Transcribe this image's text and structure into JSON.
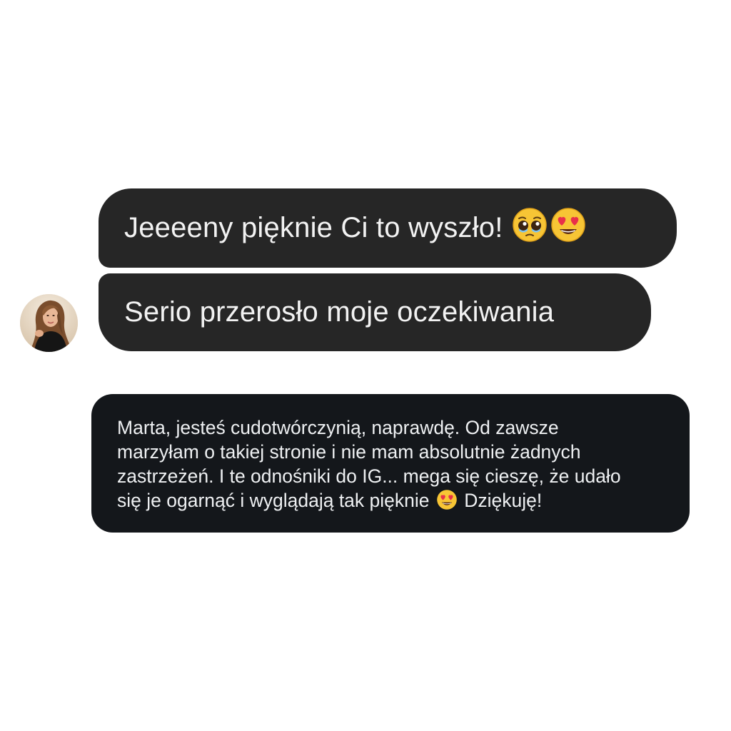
{
  "conversation": {
    "messages": [
      {
        "text": "Jeeeeny pięknie Ci to wyszło!",
        "emojis": [
          "pleading-face-icon",
          "heart-eyes-face-icon"
        ]
      },
      {
        "text": "Serio przerosło moje oczekiwania"
      }
    ],
    "avatar": {
      "icon": "avatar-woman-photo"
    }
  },
  "testimonial": {
    "lines": [
      "Marta, jesteś cudotwórczynią, naprawdę. Od zawsze",
      "marzyłam o takiej stronie i nie mam absolutnie żadnych",
      "zastrzeżeń. I te odnośniki do IG... mega się cieszę, że udało",
      "się je ogarnąć i wyglądają tak pięknie"
    ],
    "closing": "Dziękuję!",
    "inline_emoji": "heart-eyes-face-icon"
  },
  "colors": {
    "bubble": "#262626",
    "card": "#14171b",
    "emoji_face": "#f7c535"
  }
}
